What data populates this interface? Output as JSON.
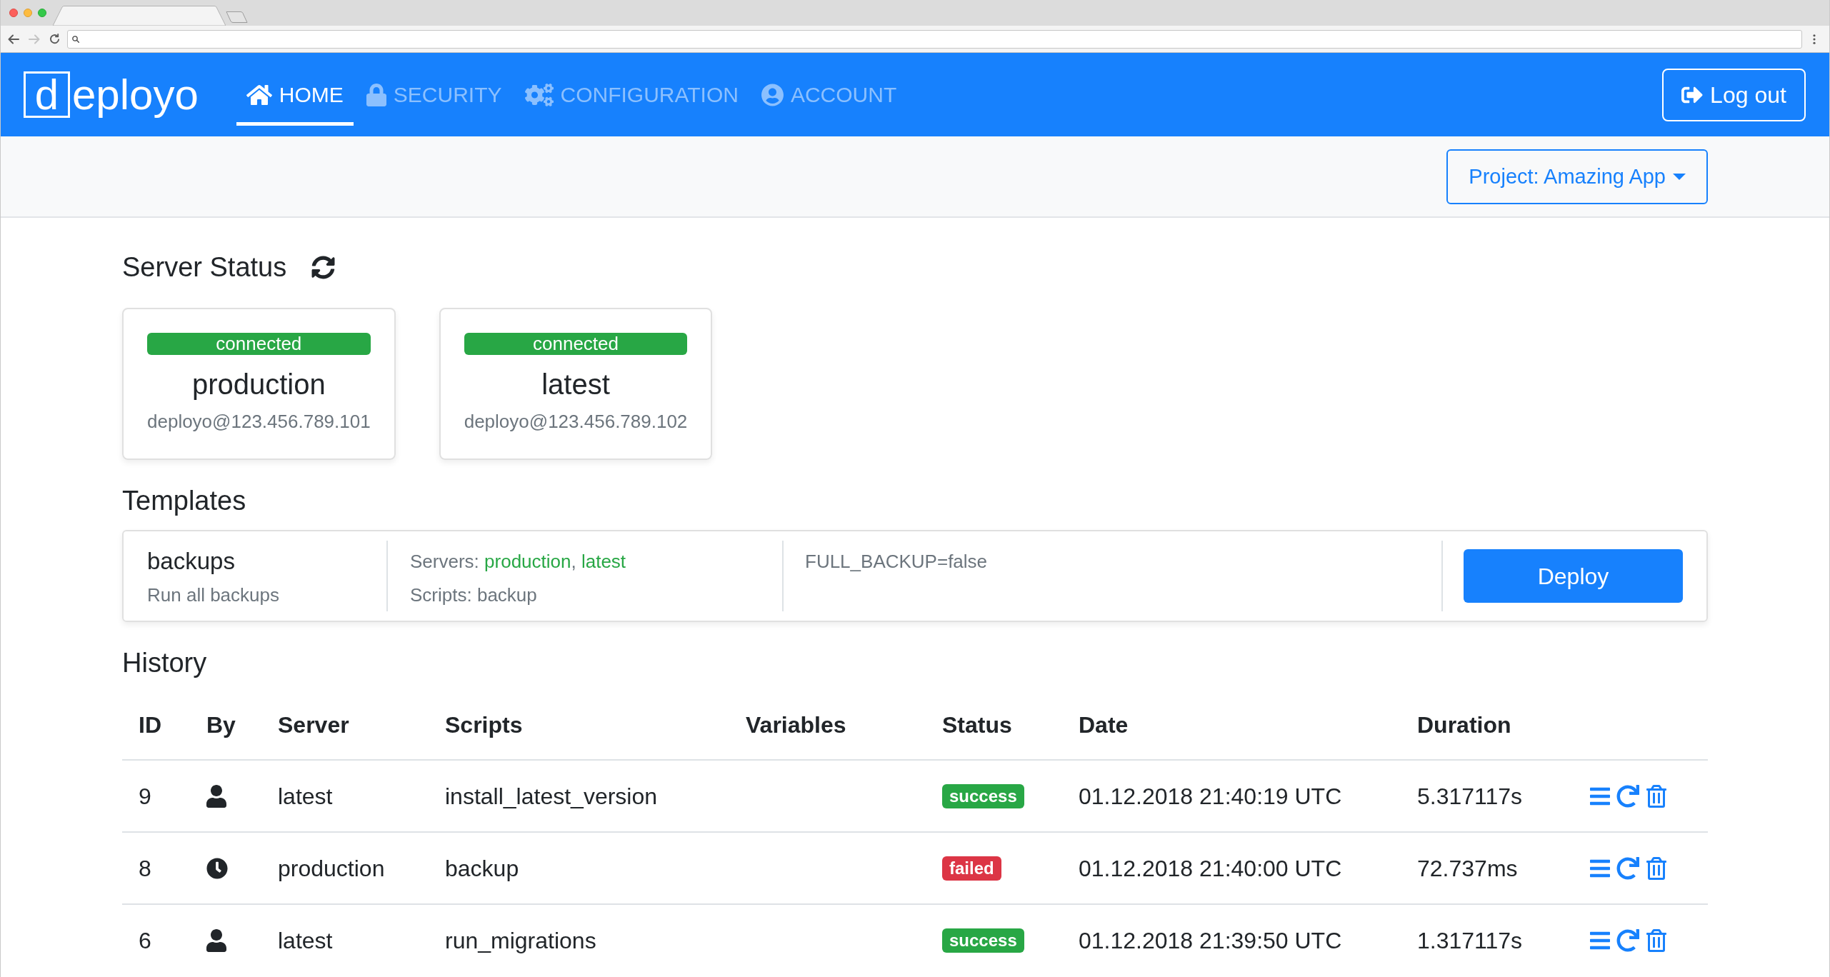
{
  "browser": {
    "buttons": [
      {
        "kind": "back",
        "disabled": false
      },
      {
        "kind": "forward",
        "disabled": true
      },
      {
        "kind": "reload",
        "disabled": false
      }
    ]
  },
  "navbar": {
    "logo": {
      "boxed": "d",
      "text": "eployo"
    },
    "tabs": [
      {
        "label": "HOME",
        "selected": true
      },
      {
        "label": "SECURITY",
        "selected": false
      },
      {
        "label": "CONFIGURATION",
        "selected": false
      },
      {
        "label": "ACCOUNT",
        "selected": false
      }
    ],
    "logout": "Log out"
  },
  "toolbar": {
    "project_menu": "Project: Amazing App"
  },
  "server_status": {
    "title": "Server Status",
    "servers": [
      {
        "status": {
          "label": "connected",
          "color": "#28a745"
        },
        "name": "production",
        "address": "deployo@123.456.789.101"
      },
      {
        "status": {
          "label": "connected",
          "color": "#28a745"
        },
        "name": "latest",
        "address": "deployo@123.456.789.102"
      }
    ]
  },
  "templates": {
    "title": "Templates",
    "items": [
      {
        "name": "backups",
        "description": "Run all backups",
        "servers_label": "Servers:",
        "servers": [
          "production",
          "latest"
        ],
        "servers_separator": ",",
        "scripts_label": "Scripts:",
        "scripts": "backup",
        "variables": "FULL_BACKUP=false",
        "action": "Deploy"
      }
    ]
  },
  "history": {
    "title": "History",
    "columns": [
      "ID",
      "By",
      "Server",
      "Scripts",
      "Variables",
      "Status",
      "Date",
      "Duration"
    ],
    "rows": [
      {
        "id": "9",
        "by": {
          "kind": "user"
        },
        "server": "latest",
        "scripts": "install_latest_version",
        "status": {
          "label": "success",
          "color": "#28a745"
        },
        "date": "01.12.2018 21:40:19 UTC",
        "duration": "5.317117s"
      },
      {
        "id": "8",
        "by": {
          "kind": "schedule"
        },
        "server": "production",
        "scripts": "backup",
        "status": {
          "label": "failed",
          "color": "#dc3545"
        },
        "date": "01.12.2018 21:40:00 UTC",
        "duration": "72.737ms"
      },
      {
        "id": "6",
        "by": {
          "kind": "user"
        },
        "server": "latest",
        "scripts": "run_migrations",
        "status": {
          "label": "success",
          "color": "#28a745"
        },
        "date": "01.12.2018 21:39:50 UTC",
        "duration": "1.317117s"
      }
    ]
  }
}
